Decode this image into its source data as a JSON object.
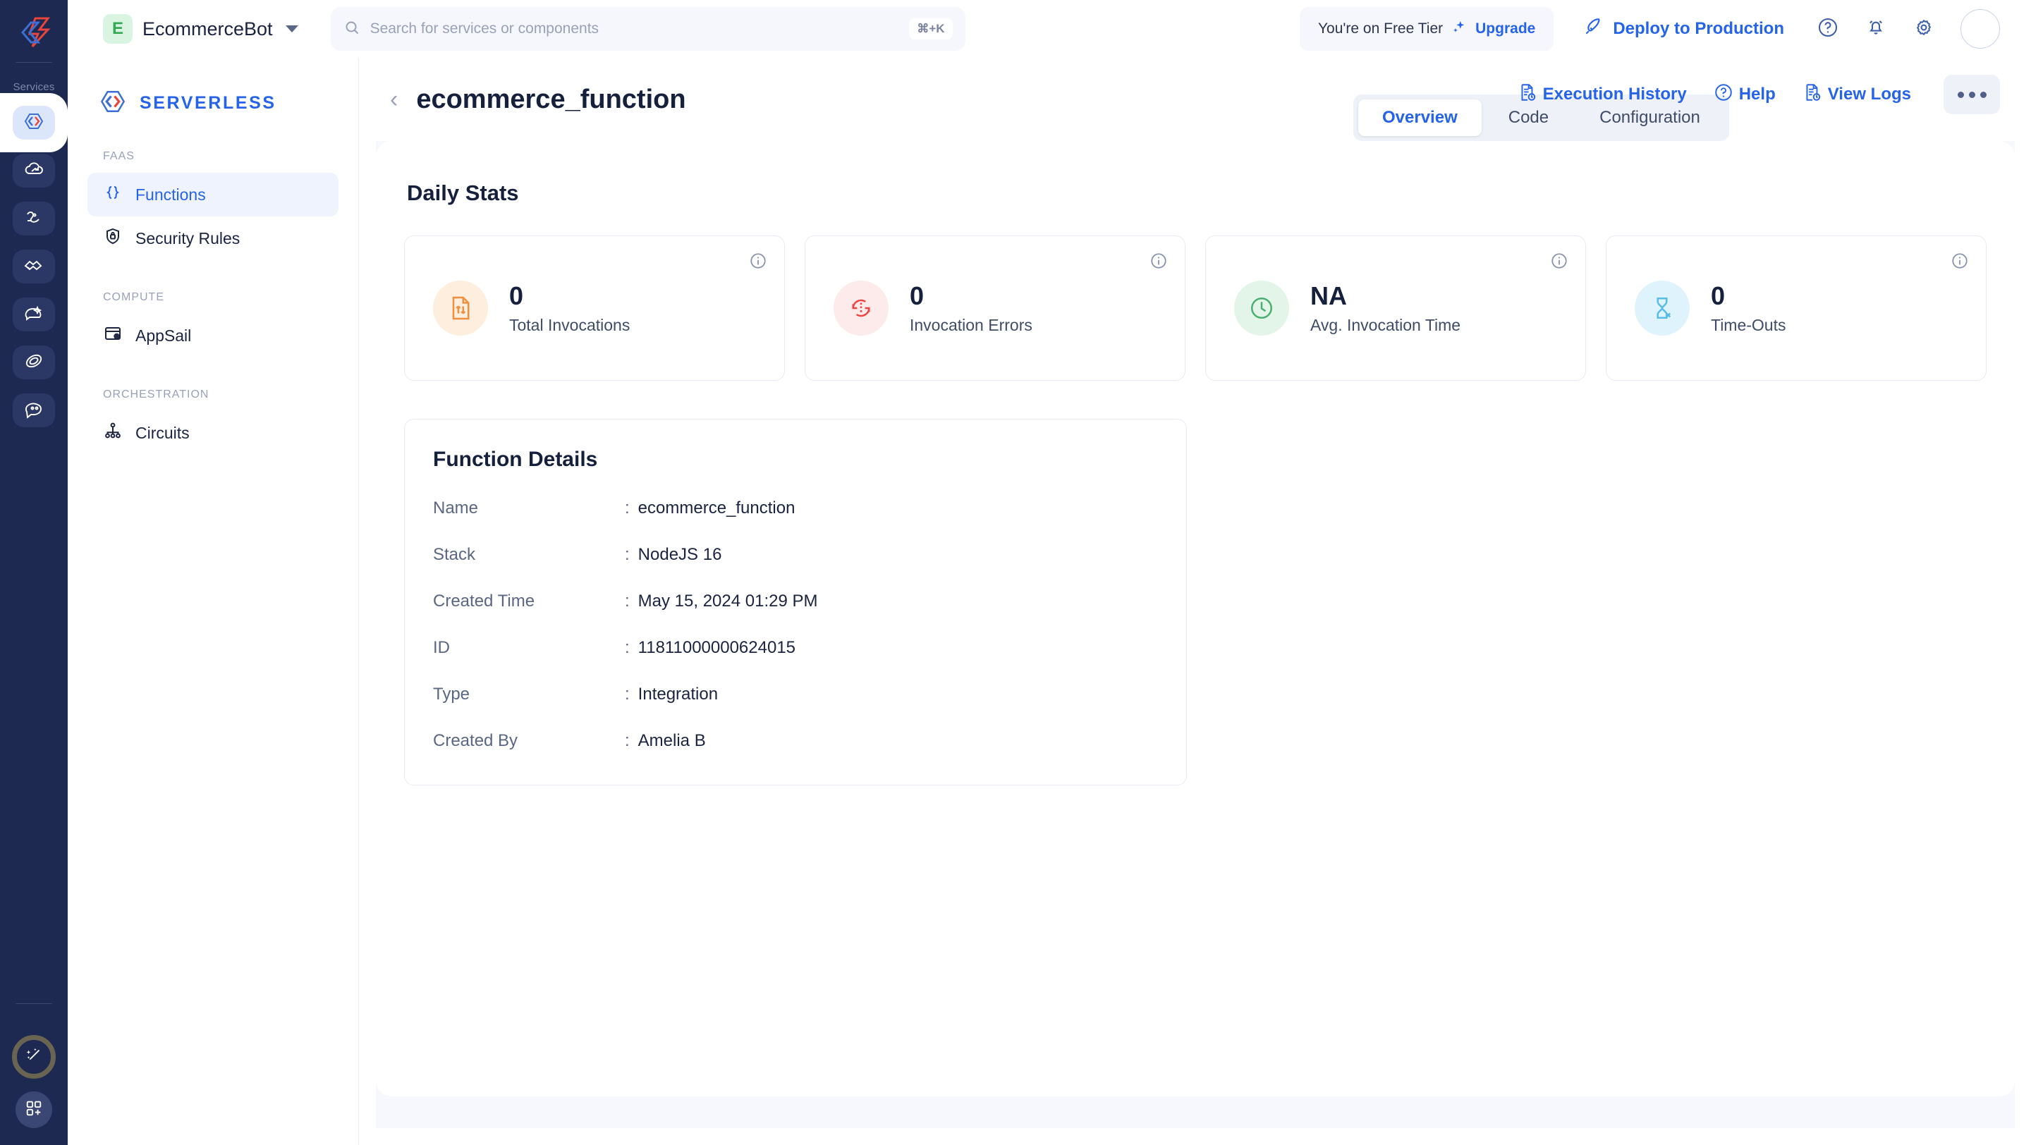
{
  "rail": {
    "logo_icon": "zoho-arrow-logo",
    "services_label": "Services",
    "items": [
      {
        "name": "serverless",
        "icon": "code-brackets-icon",
        "active": true
      },
      {
        "name": "catalyst-cloud",
        "icon": "cloud-upload-icon",
        "active": false
      },
      {
        "name": "data-store",
        "icon": "data-flow-icon",
        "active": false
      },
      {
        "name": "integrations",
        "icon": "handshake-icon",
        "active": false
      },
      {
        "name": "ai-chat",
        "icon": "chat-sparkle-icon",
        "active": false
      },
      {
        "name": "orbit",
        "icon": "galaxy-spiral-icon",
        "active": false
      },
      {
        "name": "support-chat",
        "icon": "chat-face-icon",
        "active": false
      }
    ],
    "bottom": [
      {
        "name": "magic-wand",
        "icon": "magic-wand-icon"
      },
      {
        "name": "app-grid-add",
        "icon": "grid-plus-icon"
      }
    ]
  },
  "topbar": {
    "org_initial": "E",
    "org_name": "EcommerceBot",
    "org_caret_icon": "chevron-down-icon",
    "search": {
      "icon": "search-icon",
      "placeholder": "Search for services or components",
      "shortcut": "⌘+K"
    },
    "tier_text": "You're on Free Tier",
    "upgrade_label": "Upgrade",
    "upgrade_icon": "sparkle-icon",
    "deploy_label": "Deploy to Production",
    "deploy_icon": "rocket-icon",
    "icons": [
      {
        "name": "help-circle-icon"
      },
      {
        "name": "bell-icon"
      },
      {
        "name": "gear-icon"
      },
      {
        "name": "user-avatar"
      }
    ]
  },
  "subnav": {
    "brand": "SERVERLESS",
    "brand_icon": "serverless-hex-icon",
    "sections": [
      {
        "label": "FAAS",
        "items": [
          {
            "label": "Functions",
            "icon": "curly-braces-icon",
            "active": true
          },
          {
            "label": "Security Rules",
            "icon": "shield-lock-icon",
            "active": false
          }
        ]
      },
      {
        "label": "COMPUTE",
        "items": [
          {
            "label": "AppSail",
            "icon": "window-gear-icon",
            "active": false
          }
        ]
      },
      {
        "label": "ORCHESTRATION",
        "items": [
          {
            "label": "Circuits",
            "icon": "sitemap-icon",
            "active": false
          }
        ]
      }
    ]
  },
  "page": {
    "back_icon": "chevron-left-icon",
    "title": "ecommerce_function",
    "tabs": [
      {
        "label": "Overview",
        "active": true
      },
      {
        "label": "Code",
        "active": false
      },
      {
        "label": "Configuration",
        "active": false
      }
    ],
    "actions": [
      {
        "label": "Execution History",
        "icon": "document-clock-icon"
      },
      {
        "label": "Help",
        "icon": "help-circle-icon"
      },
      {
        "label": "View Logs",
        "icon": "document-clock-icon"
      }
    ],
    "more_label": "•••",
    "more_icon": "ellipsis-icon"
  },
  "stats": {
    "section_title": "Daily Stats",
    "info_icon": "info-icon",
    "cards": [
      {
        "value": "0",
        "label": "Total Invocations",
        "icon": "file-transfer-icon",
        "icon_color": "#f0903f",
        "icon_bg": "#fdeede"
      },
      {
        "value": "0",
        "label": "Invocation Errors",
        "icon": "error-refresh-icon",
        "icon_color": "#ef4444",
        "icon_bg": "#fdeaea"
      },
      {
        "value": "NA",
        "label": "Avg. Invocation Time",
        "icon": "clock-icon",
        "icon_color": "#4caf72",
        "icon_bg": "#e2f5e8"
      },
      {
        "value": "0",
        "label": "Time-Outs",
        "icon": "hourglass-x-icon",
        "icon_color": "#56bce8",
        "icon_bg": "#dff3fc"
      }
    ]
  },
  "details": {
    "title": "Function Details",
    "rows": [
      {
        "key": "Name",
        "value": "ecommerce_function"
      },
      {
        "key": "Stack",
        "value": "NodeJS 16"
      },
      {
        "key": "Created Time",
        "value": "May 15, 2024 01:29 PM"
      },
      {
        "key": "ID",
        "value": "11811000000624015"
      },
      {
        "key": "Type",
        "value": "Integration"
      },
      {
        "key": "Created By",
        "value": "Amelia B"
      }
    ]
  },
  "colors": {
    "rail_bg": "#1d2951",
    "accent_blue": "#2563eb",
    "content_bg": "#f7f8fd",
    "logo_red": "#e8453c",
    "logo_blue": "#3b6fd4"
  }
}
